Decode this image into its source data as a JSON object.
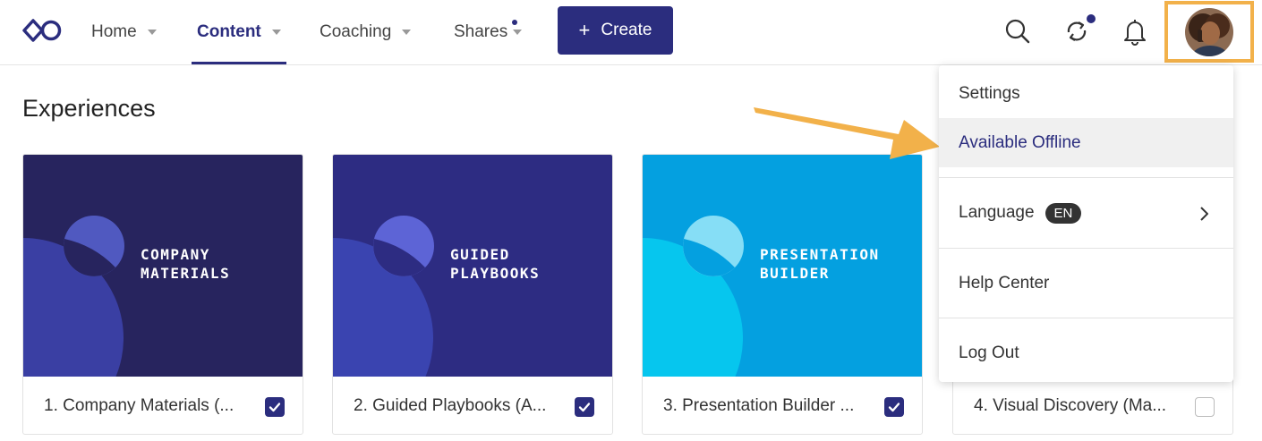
{
  "header": {
    "nav": [
      {
        "label": "Home"
      },
      {
        "label": "Content"
      },
      {
        "label": "Coaching"
      },
      {
        "label": "Shares"
      }
    ],
    "create_label": "Create"
  },
  "main": {
    "section_title": "Experiences",
    "cards": [
      {
        "thumb_title": "COMPANY\nMATERIALS",
        "label": "1. Company Materials (...",
        "checked": true
      },
      {
        "thumb_title": "GUIDED\nPLAYBOOKS",
        "label": "2. Guided Playbooks (A...",
        "checked": true
      },
      {
        "thumb_title": "PRESENTATION\nBUILDER",
        "label": "3. Presentation Builder ...",
        "checked": true
      },
      {
        "label": "4. Visual Discovery (Ma...",
        "checked": false
      }
    ]
  },
  "user_menu": {
    "items": [
      {
        "label": "Settings"
      },
      {
        "label": "Available Offline"
      },
      {
        "label": "Language",
        "badge": "EN"
      },
      {
        "label": "Help Center"
      },
      {
        "label": "Log Out"
      }
    ]
  },
  "colors": {
    "brand": "#2b2d7e",
    "highlight_border": "#f2b14a",
    "annotation_arrow": "#f2b14a"
  }
}
